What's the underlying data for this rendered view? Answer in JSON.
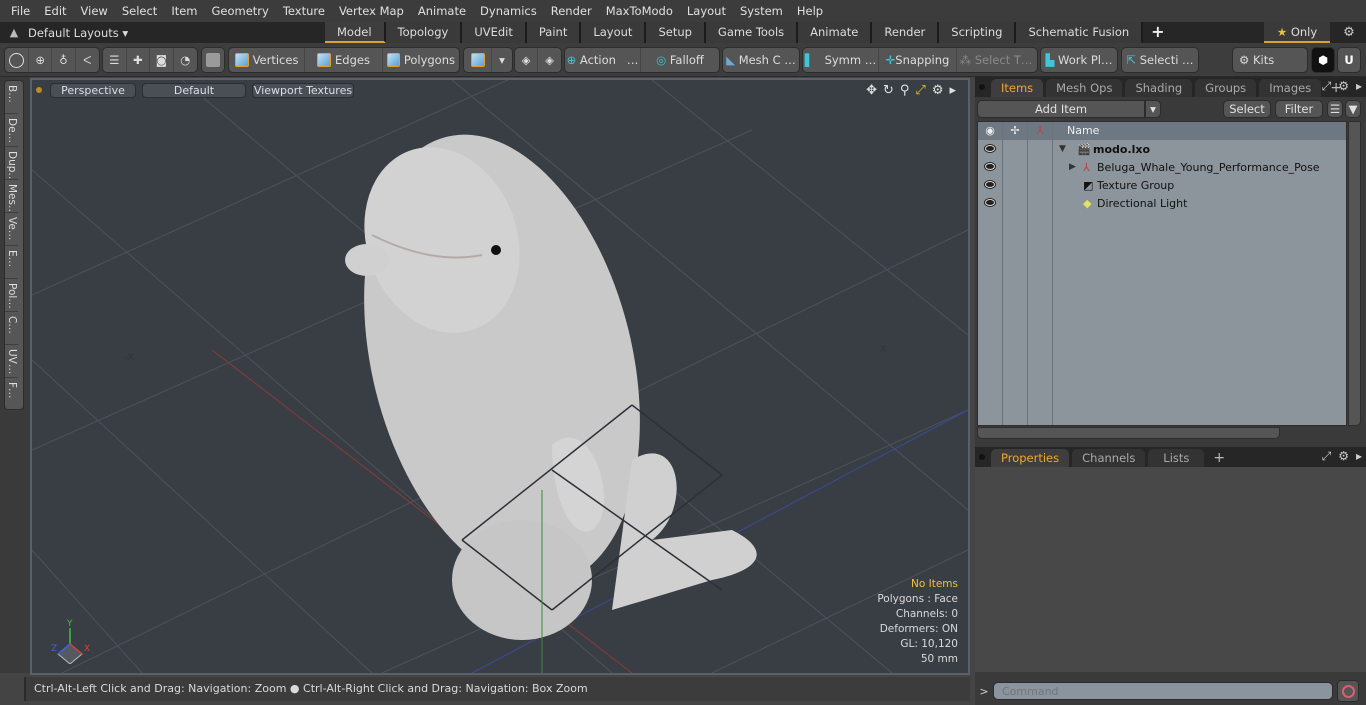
{
  "menubar": [
    "File",
    "Edit",
    "View",
    "Select",
    "Item",
    "Geometry",
    "Texture",
    "Vertex Map",
    "Animate",
    "Dynamics",
    "Render",
    "MaxToModo",
    "Layout",
    "System",
    "Help"
  ],
  "layoutbar": {
    "layouts_label": "Default Layouts ▾",
    "tabs": [
      "Model",
      "Topology",
      "UVEdit",
      "Paint",
      "Layout",
      "Setup",
      "Game Tools",
      "Animate",
      "Render",
      "Scripting",
      "Schematic Fusion"
    ],
    "active_tab": "Model",
    "add_tab": "+",
    "only_label": "Only",
    "only_icon": "★"
  },
  "toolbar": {
    "vertices": "Vertices",
    "edges": "Edges",
    "polygons": "Polygons",
    "action": "Action",
    "action_more": "…",
    "falloff": "Falloff",
    "mesh_c": "Mesh C …",
    "symm": "Symm …",
    "snapping": "Snapping",
    "select_t": "Select T…",
    "work_pl": "Work Pl…",
    "selecti": "Selecti …",
    "kits": "Kits"
  },
  "left_strip": [
    "B…",
    "De…",
    "Dup…",
    "Mes…",
    "Ve…",
    "E…",
    "Pol…",
    "C…",
    "UV…",
    "F…"
  ],
  "viewport": {
    "view_mode": "Perspective",
    "shading": "Default",
    "textures": "Viewport Textures",
    "stats": {
      "selection": "No Items",
      "polygons": "Polygons : Face",
      "channels": "Channels: 0",
      "deformers": "Deformers: ON",
      "gl": "GL: 10,120",
      "focal": "50 mm"
    },
    "axis_labels": {
      "x": "X",
      "y": "Y",
      "z": "Z"
    },
    "model_description": "3D model of a young beluga whale in performance pose"
  },
  "statusbar": {
    "hint_left": "Ctrl-Alt-Left Click and Drag: Navigation: Zoom",
    "separator": "●",
    "hint_right": "Ctrl-Alt-Right Click and Drag: Navigation: Box Zoom"
  },
  "items_panel": {
    "tabs": [
      "Items",
      "Mesh Ops",
      "Shading",
      "Groups",
      "Images"
    ],
    "active_tab": "Items",
    "add_tab": "+",
    "add_item": "Add Item",
    "select": "Select",
    "filter": "Filter",
    "name_header": "Name",
    "tree": [
      {
        "name": "modo.lxo",
        "icon": "scene-icon",
        "bold": true,
        "expander": "▼",
        "depth": 0
      },
      {
        "name": "Beluga_Whale_Young_Performance_Pose",
        "icon": "mesh-locator-icon",
        "bold": false,
        "expander": "▶",
        "depth": 1
      },
      {
        "name": "Texture Group",
        "icon": "texture-group-icon",
        "bold": false,
        "expander": "",
        "depth": 1
      },
      {
        "name": "Directional Light",
        "icon": "light-icon",
        "bold": false,
        "expander": "",
        "depth": 1
      }
    ]
  },
  "properties_panel": {
    "tabs": [
      "Properties",
      "Channels",
      "Lists"
    ],
    "active_tab": "Properties",
    "add_tab": "+"
  },
  "command": {
    "prompt": ">",
    "placeholder": "Command"
  },
  "colors": {
    "accent": "#e0a030",
    "active_tab_text": "#f0a830",
    "viewport_bg": "#393e44",
    "tree_bg": "#8c949c"
  }
}
